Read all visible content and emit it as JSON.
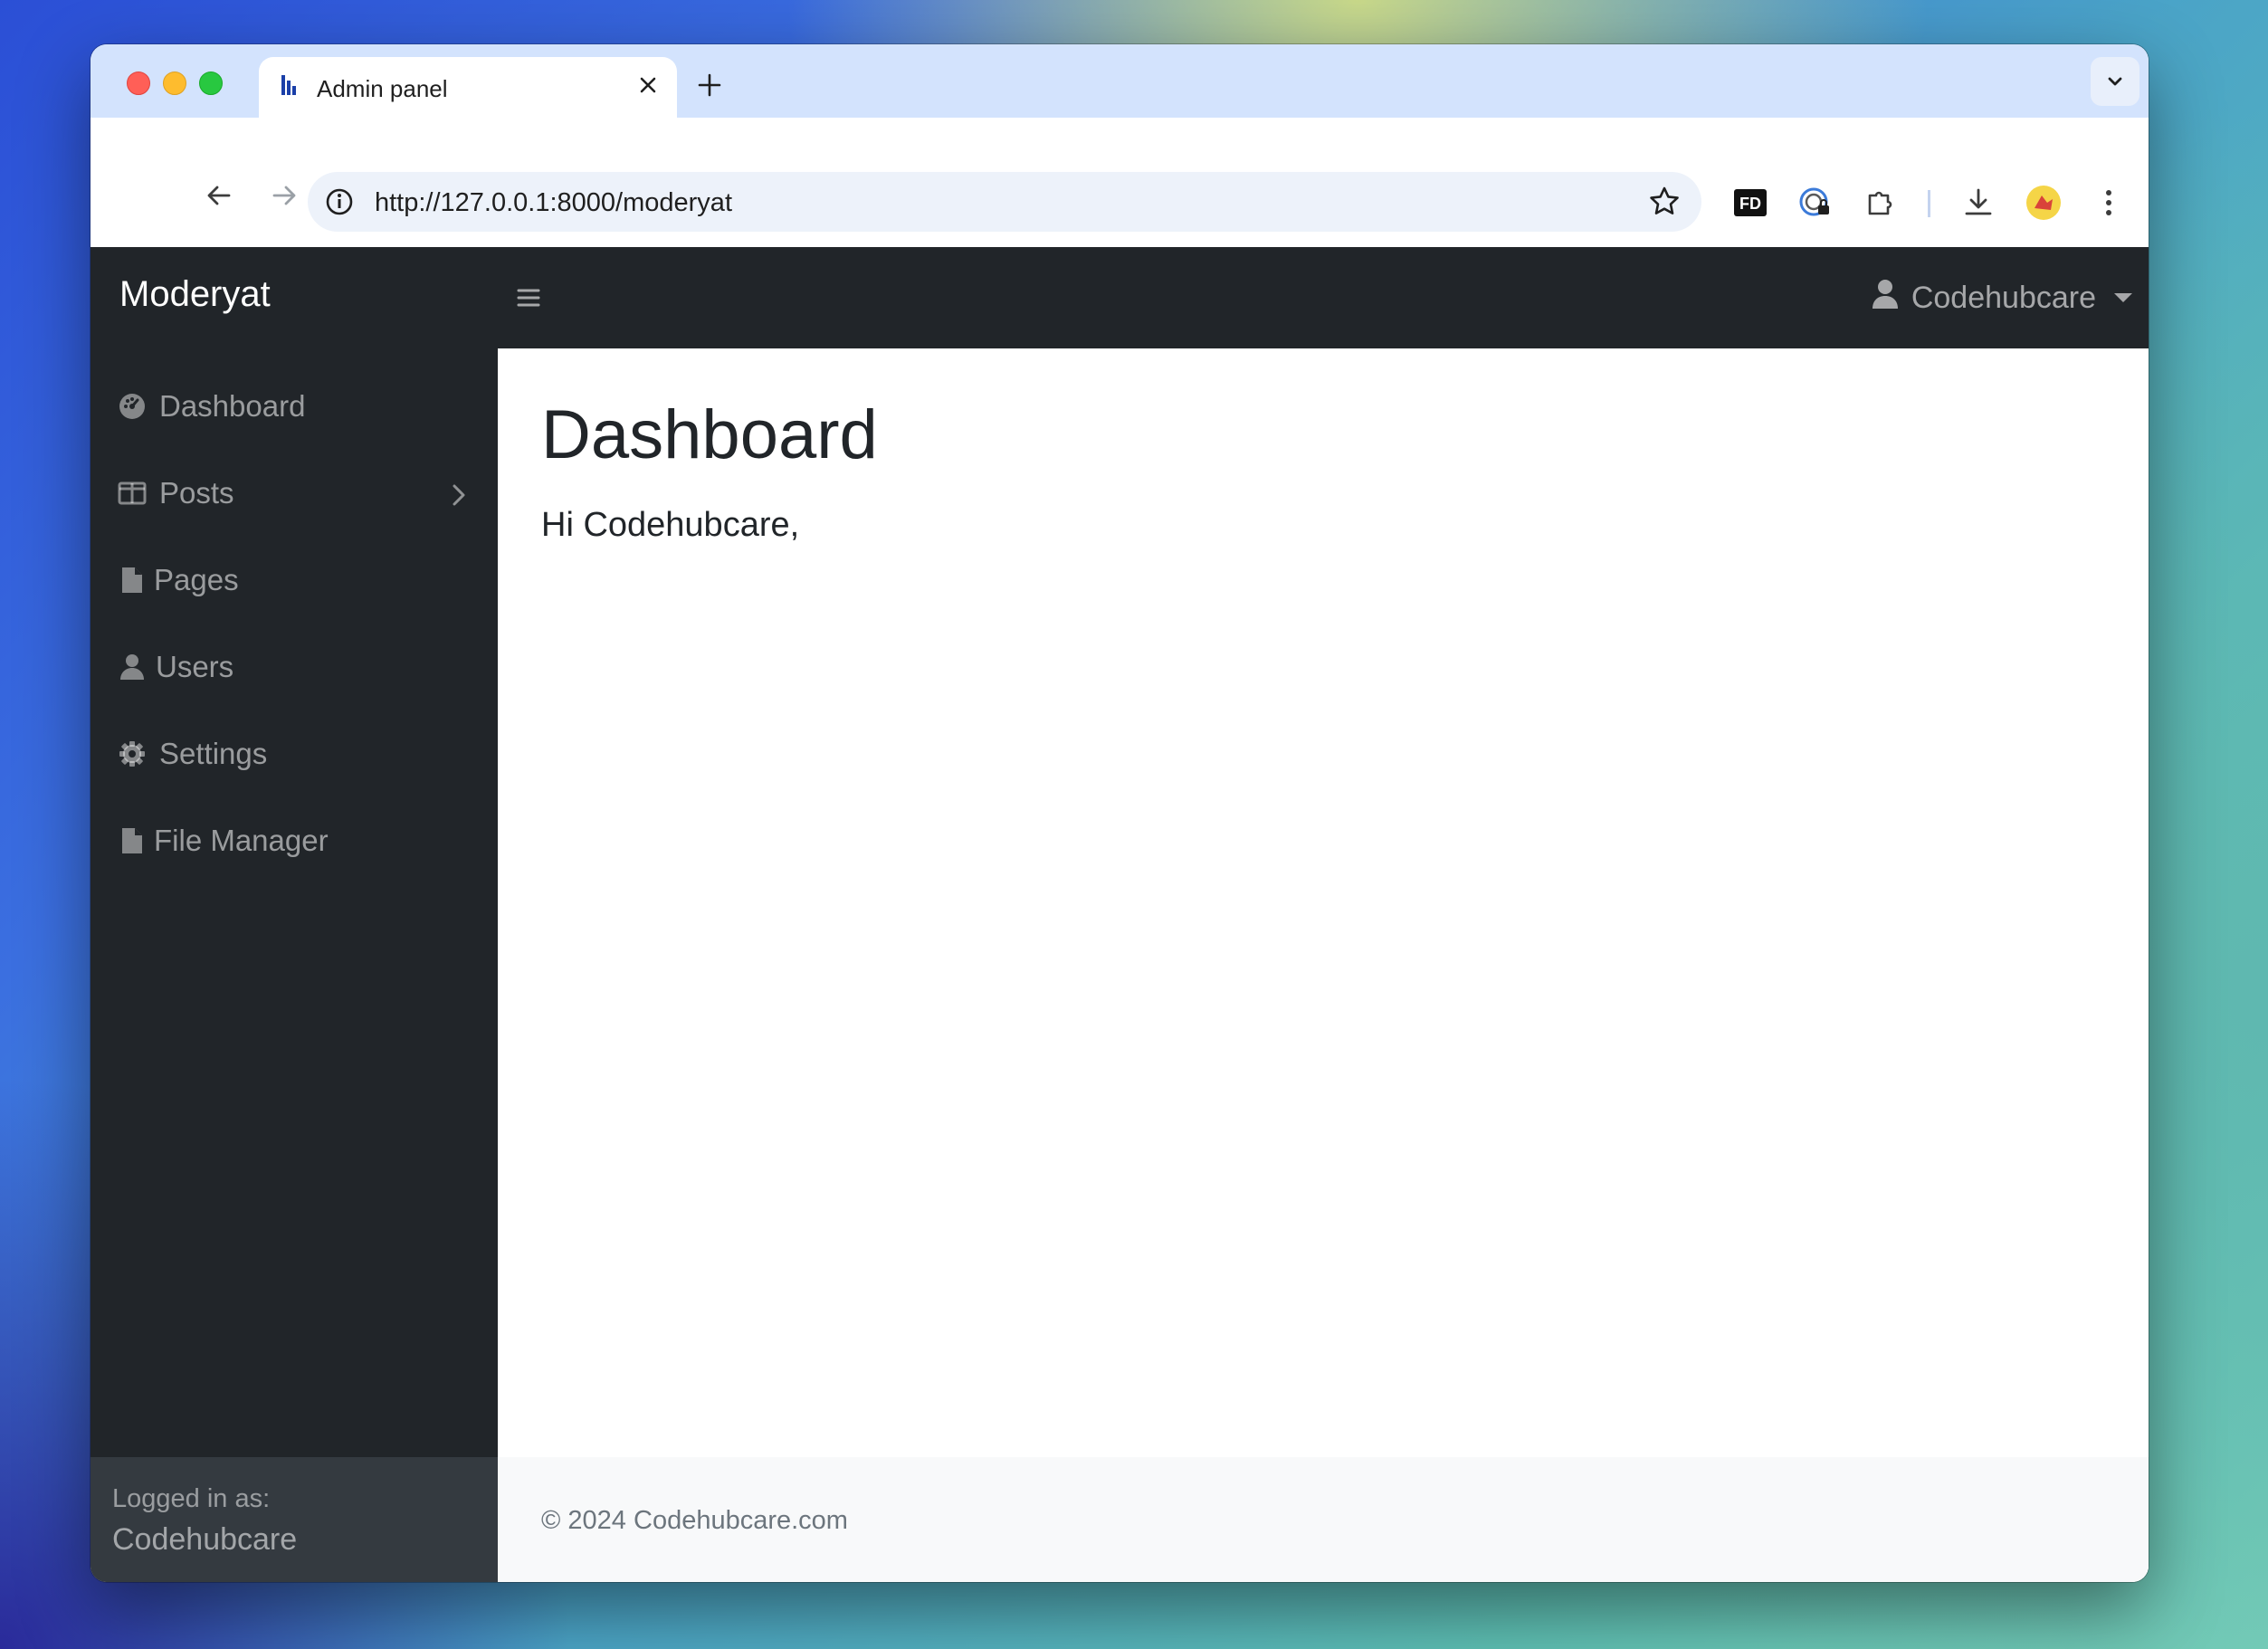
{
  "browser": {
    "tab_title": "Admin panel",
    "url": "http://127.0.0.1:8000/moderyat",
    "extensions": [
      "fd-extension-icon",
      "password-manager-icon",
      "extensions-puzzle-icon",
      "download-icon",
      "profile-avatar-icon",
      "menu-kebab-icon"
    ]
  },
  "app": {
    "brand": "Moderyat",
    "user_menu_label": "Codehubcare"
  },
  "sidebar": {
    "items": [
      {
        "label": "Dashboard",
        "icon": "gauge-icon"
      },
      {
        "label": "Posts",
        "icon": "columns-icon",
        "has_submenu": true
      },
      {
        "label": "Pages",
        "icon": "file-icon"
      },
      {
        "label": "Users",
        "icon": "user-icon"
      },
      {
        "label": "Settings",
        "icon": "gear-icon"
      },
      {
        "label": "File Manager",
        "icon": "file-icon"
      }
    ],
    "footer_label": "Logged in as:",
    "footer_user": "Codehubcare"
  },
  "main": {
    "title": "Dashboard",
    "greeting": "Hi Codehubcare,"
  },
  "footer": {
    "copyright": "© 2024 Codehubcare.com"
  },
  "colors": {
    "navbar": "#212529",
    "sidebar_footer": "#343a40",
    "tabstrip": "#d3e3fd",
    "footer_bg": "#f8f9fa"
  }
}
